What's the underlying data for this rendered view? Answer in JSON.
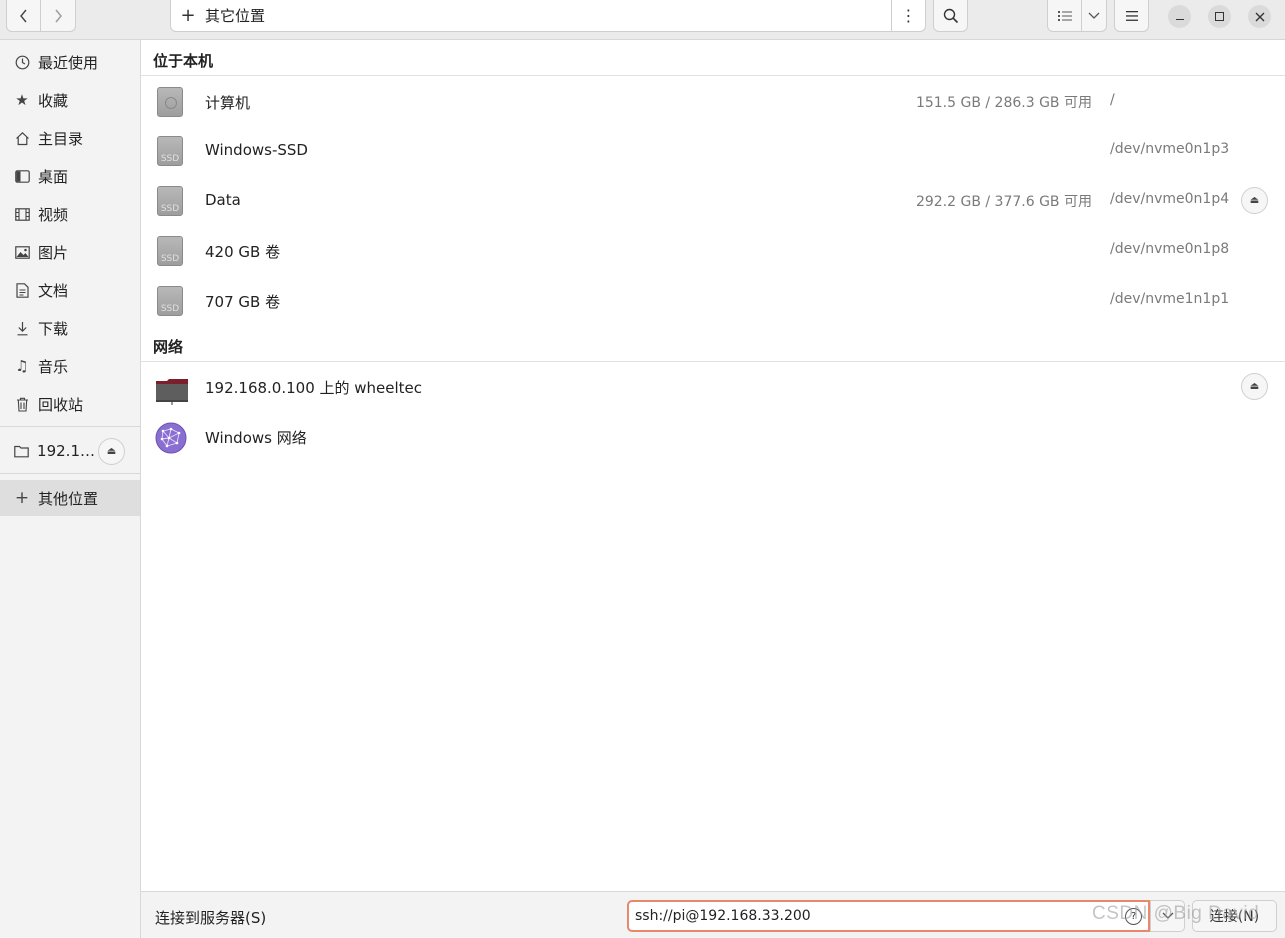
{
  "header": {
    "location": "其它位置"
  },
  "sidebar": {
    "items": [
      {
        "label": "最近使用",
        "icon": "clock-icon"
      },
      {
        "label": "收藏",
        "icon": "star-icon"
      },
      {
        "label": "主目录",
        "icon": "home-icon"
      },
      {
        "label": "桌面",
        "icon": "desktop-icon"
      },
      {
        "label": "视频",
        "icon": "film-icon"
      },
      {
        "label": "图片",
        "icon": "picture-icon"
      },
      {
        "label": "文档",
        "icon": "document-icon"
      },
      {
        "label": "下载",
        "icon": "download-icon"
      },
      {
        "label": "音乐",
        "icon": "music-icon"
      },
      {
        "label": "回收站",
        "icon": "trash-icon"
      }
    ],
    "mount": {
      "label": "192.1…",
      "icon": "folder-icon"
    },
    "other_locations": {
      "label": "其他位置",
      "icon": "plus-icon"
    }
  },
  "main": {
    "local_section": "位于本机",
    "local_rows": [
      {
        "name": "计算机",
        "available": "151.5 GB / 286.3 GB 可用",
        "device": "/",
        "icon": "computer-disk-icon"
      },
      {
        "name": "Windows-SSD",
        "available": "",
        "device": "/dev/nvme0n1p3",
        "icon": "ssd-icon"
      },
      {
        "name": "Data",
        "available": "292.2 GB / 377.6 GB 可用",
        "device": "/dev/nvme0n1p4",
        "icon": "ssd-icon"
      },
      {
        "name": "420 GB 卷",
        "available": "",
        "device": "/dev/nvme0n1p8",
        "icon": "ssd-icon"
      },
      {
        "name": "707 GB 卷",
        "available": "",
        "device": "/dev/nvme1n1p1",
        "icon": "ssd-icon"
      }
    ],
    "ssd_label": "SSD",
    "network_section": "网络",
    "network_rows": [
      {
        "name": "192.168.0.100 上的 wheeltec",
        "icon": "network-folder-icon"
      },
      {
        "name": "Windows 网络",
        "icon": "network-globe-icon"
      }
    ]
  },
  "bottom": {
    "connect_label": "连接到服务器(S)",
    "server_value": "ssh://pi@192.168.33.200",
    "connect_button": "连接(N)",
    "watermark": "CSDN @Big David"
  },
  "colors": {
    "input_focus": "#e9886a",
    "network_folder": "#7a1f2b",
    "globe": "#8a6fd1"
  }
}
